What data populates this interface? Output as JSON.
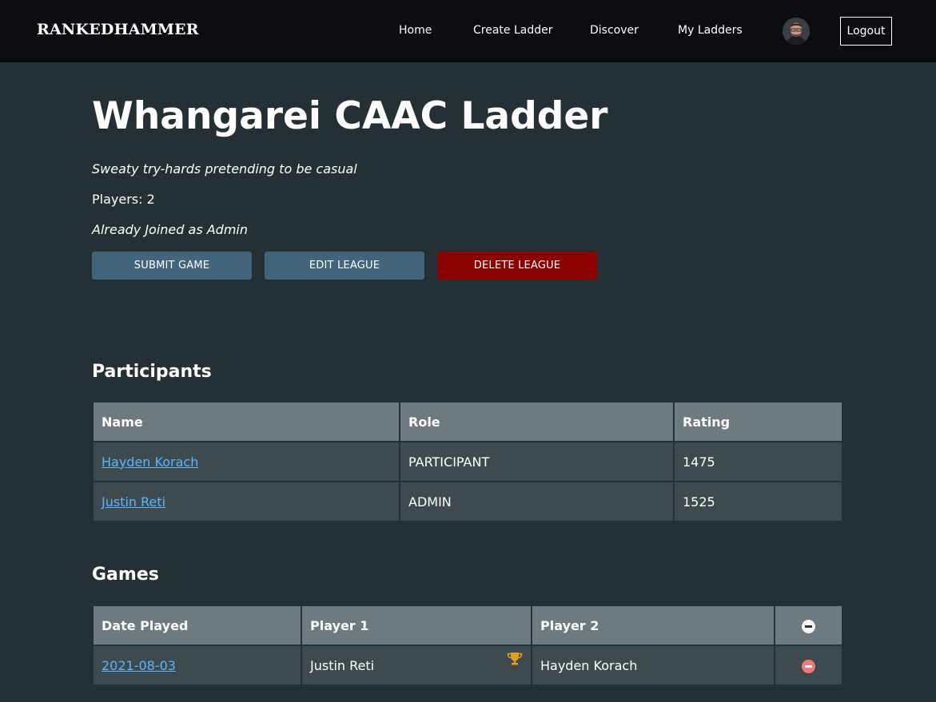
{
  "nav": {
    "brand": "RANKEDHAMMER",
    "links": [
      "Home",
      "Create Ladder",
      "Discover",
      "My Ladders"
    ],
    "logout": "Logout"
  },
  "ladder": {
    "title": "Whangarei CAAC Ladder",
    "description": "Sweaty try-hards pretending to be casual",
    "players": "Players: 2",
    "status": "Already Joined as Admin"
  },
  "actions": {
    "submit": "SUBMIT GAME",
    "edit": "EDIT LEAGUE",
    "delete": "DELETE LEAGUE"
  },
  "participants": {
    "title": "Participants",
    "headers": [
      "Name",
      "Role",
      "Rating"
    ],
    "rows": [
      {
        "name": "Hayden Korach",
        "role": "PARTICIPANT",
        "rating": "1475"
      },
      {
        "name": "Justin Reti",
        "role": "ADMIN",
        "rating": "1525"
      }
    ]
  },
  "games": {
    "title": "Games",
    "headers": [
      "Date Played",
      "Player 1",
      "Player 2"
    ],
    "rows": [
      {
        "date": "2021-08-03",
        "player1": "Justin Reti",
        "player2": "Hayden Korach",
        "winner": "player1"
      }
    ]
  },
  "colors": {
    "accent_blue": "#42657c",
    "danger_red": "#8b0000",
    "link": "#5ab4ff",
    "trophy": "#e0a21a"
  }
}
